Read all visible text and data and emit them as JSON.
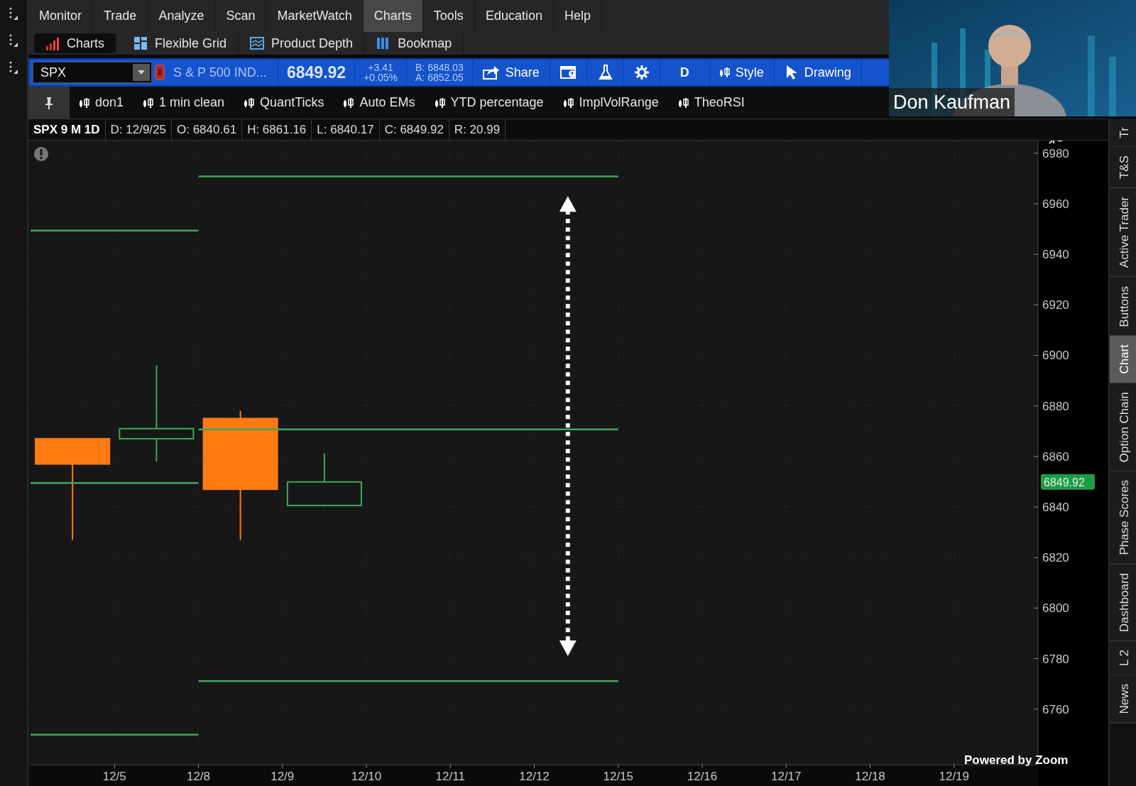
{
  "menu": [
    {
      "label": "Monitor",
      "selected": false
    },
    {
      "label": "Trade",
      "selected": false
    },
    {
      "label": "Analyze",
      "selected": false
    },
    {
      "label": "Scan",
      "selected": false
    },
    {
      "label": "MarketWatch",
      "selected": false
    },
    {
      "label": "Charts",
      "selected": true
    },
    {
      "label": "Tools",
      "selected": false
    },
    {
      "label": "Education",
      "selected": false
    },
    {
      "label": "Help",
      "selected": false
    }
  ],
  "subtabs": [
    {
      "kind": "charts",
      "label": "Charts",
      "selected": true
    },
    {
      "kind": "grid",
      "label": "Flexible Grid",
      "selected": false
    },
    {
      "kind": "depth",
      "label": "Product Depth",
      "selected": false
    },
    {
      "kind": "bookmap",
      "label": "Bookmap",
      "selected": false
    }
  ],
  "symbol_bar": {
    "symbol": "SPX",
    "description": "S & P 500 IND...",
    "last": "6849.92",
    "change": "+3.41",
    "change_pct": "+0.05%",
    "bid": "B: 6848.03",
    "ask": "A: 6852.05",
    "buttons": [
      {
        "kind": "share",
        "label": "Share"
      },
      {
        "kind": "alert"
      },
      {
        "kind": "flask"
      },
      {
        "kind": "gear"
      },
      {
        "kind": "aggregation",
        "label": "D"
      },
      {
        "kind": "style",
        "label": "Style"
      },
      {
        "kind": "drawings",
        "label": "Drawing"
      }
    ]
  },
  "studies": [
    "don1",
    "1 min clean",
    "QuantTicks",
    "Auto EMs",
    "YTD percentage",
    "ImplVolRange",
    "TheoRSI"
  ],
  "chart_header": {
    "title": "SPX 9 M 1D",
    "fields": [
      "D: 12/9/25",
      "O: 6840.61",
      "H: 6861.16",
      "L: 6840.17",
      "C: 6849.92",
      "R: 20.99"
    ]
  },
  "chart": {
    "price_badge": "6849.92",
    "chart_data": {
      "type": "line",
      "categories": [
        null,
        "12/5",
        "12/8",
        "12/9",
        "12/10",
        "12/11",
        "12/12",
        "12/15",
        "12/16",
        "12/17",
        "12/18",
        "12/19",
        null
      ],
      "series": [
        {
          "color": "#3fa95a",
          "values": [
            6949.4,
            null,
            6949.4,
            null,
            null,
            null,
            null,
            null,
            null,
            null,
            null,
            null,
            null
          ]
        },
        {
          "color": "#3fa95a",
          "values": [
            6849.5,
            null,
            6849.5,
            null,
            null,
            null,
            null,
            null,
            null,
            null,
            null,
            null,
            null
          ]
        },
        {
          "color": "#3fa95a",
          "values": [
            6749.9,
            null,
            6749.9,
            null,
            null,
            null,
            null,
            null,
            null,
            null,
            null,
            null,
            null
          ]
        },
        {
          "color": "#3fa95a",
          "values": [
            null,
            null,
            6970.8,
            null,
            null,
            null,
            null,
            6970.8,
            null,
            null,
            null,
            null,
            null
          ]
        },
        {
          "color": "#3fa95a",
          "values": [
            null,
            null,
            6870.7,
            null,
            null,
            null,
            null,
            6870.7,
            null,
            null,
            null,
            null,
            null
          ]
        },
        {
          "color": "#3fa95a",
          "values": [
            null,
            null,
            6771.1,
            null,
            null,
            null,
            null,
            6771.1,
            null,
            null,
            null,
            null,
            null
          ]
        }
      ],
      "grid": true,
      "ylim": [
        6738,
        6985
      ],
      "yticks": [
        6760,
        6780,
        6800,
        6820,
        6840,
        6860,
        6880,
        6900,
        6920,
        6940,
        6960,
        6980
      ]
    }
  },
  "side_tabs": [
    {
      "label": "Tr",
      "selected": false
    },
    {
      "label": "T&S",
      "selected": false
    },
    {
      "label": "Active Trader",
      "selected": false
    },
    {
      "label": "Buttons",
      "selected": false
    },
    {
      "label": "Chart",
      "selected": true
    },
    {
      "label": "Option Chain",
      "selected": false
    },
    {
      "label": "Phase Scores",
      "selected": false
    },
    {
      "label": "Dashboard",
      "selected": false
    },
    {
      "label": "L 2",
      "selected": false
    },
    {
      "label": "News",
      "selected": false
    }
  ],
  "video": {
    "kind": "picture",
    "name": "Don Kaufman"
  },
  "overlay_caption": "Powered by Zoom"
}
